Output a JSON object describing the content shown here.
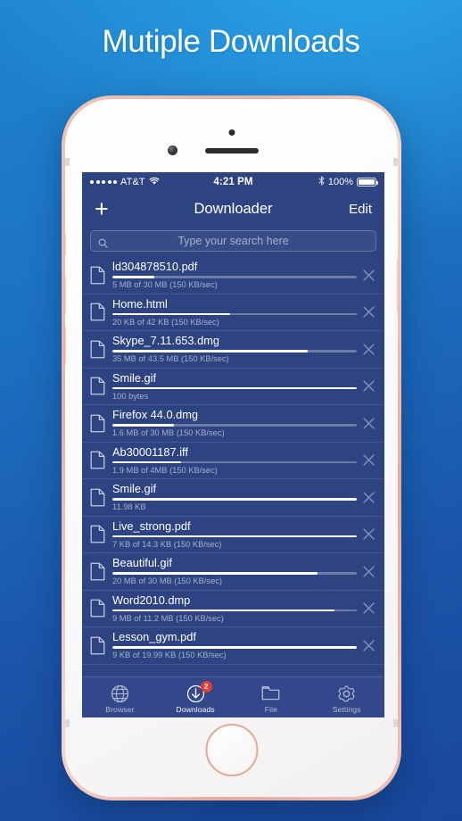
{
  "headline": "Mutiple Downloads",
  "colors": {
    "bg_top": "#2ba6e8",
    "bg_bottom": "#19479c",
    "screen_bg": "#2e4382",
    "tabbar_bg": "#33488a",
    "badge_red": "#f03b2e",
    "phone_frame": "#e8b2a6"
  },
  "status_bar": {
    "signal_dots": 5,
    "carrier": "AT&T",
    "wifi_icon": "wifi-icon",
    "time": "4:21 PM",
    "bluetooth_icon": "bluetooth-icon",
    "battery_percent": "100%",
    "battery_icon": "battery-full-icon"
  },
  "navbar": {
    "add_label": "+",
    "add_icon": "plus-icon",
    "title": "Downloader",
    "edit_label": "Edit"
  },
  "search": {
    "icon": "search-icon",
    "value": "",
    "placeholder": "Type your search here"
  },
  "downloads": [
    {
      "name": "ld304878510.pdf",
      "meta": "5 MB of 30 MB (150 KB/sec)",
      "progress": 17
    },
    {
      "name": "Home.html",
      "meta": "20 KB of 42 KB (150 KB/sec)",
      "progress": 48
    },
    {
      "name": "Skype_7.11.653.dmg",
      "meta": "35 MB of 43.5 MB (150 KB/sec)",
      "progress": 80
    },
    {
      "name": "Smile.gif",
      "meta": "100 bytes",
      "progress": 100
    },
    {
      "name": "Firefox 44.0.dmg",
      "meta": "1.6 MB of 30 MB (150 KB/sec)",
      "progress": 25
    },
    {
      "name": "Ab30001187.iff",
      "meta": "1.9 MB of 4MB (150 KB/sec)",
      "progress": 28
    },
    {
      "name": "Smile.gif",
      "meta": "11.98 KB",
      "progress": 100
    },
    {
      "name": "Live_strong.pdf",
      "meta": "7 KB of 14.3 KB (150 KB/sec)",
      "progress": 100
    },
    {
      "name": "Beautiful.gif",
      "meta": "20 MB of 30 MB (150 KB/sec)",
      "progress": 84
    },
    {
      "name": "Word2010.dmp",
      "meta": "9 MB of 11.2 MB (150 KB/sec)",
      "progress": 91
    },
    {
      "name": "Lesson_gym.pdf",
      "meta": "9 KB of 19.99 KB (150 KB/sec)",
      "progress": 100
    }
  ],
  "row_icons": {
    "file_icon": "file-document-icon",
    "close_icon": "close-x-icon"
  },
  "tabbar": {
    "items": [
      {
        "label": "Browser",
        "icon": "globe-icon",
        "badge": "",
        "active": false
      },
      {
        "label": "Downloads",
        "icon": "download-arrow-icon",
        "badge": "2",
        "active": true
      },
      {
        "label": "File",
        "icon": "folder-icon",
        "badge": "",
        "active": false
      },
      {
        "label": "Settings",
        "icon": "gear-icon",
        "badge": "",
        "active": false
      }
    ]
  }
}
